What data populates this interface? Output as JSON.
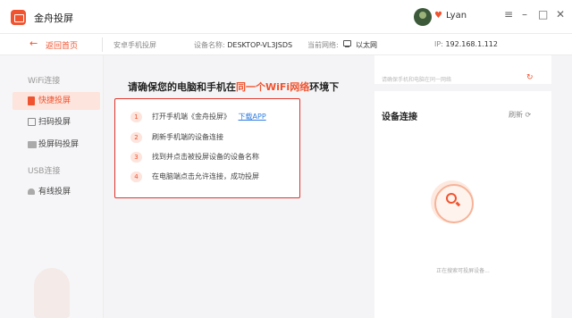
{
  "app": {
    "title": "金舟投屏",
    "user_name": "Lyan",
    "vip_symbol": "♥"
  },
  "window_controls": {
    "menu": "≡",
    "minimize": "–",
    "maximize": "□",
    "close": "✕"
  },
  "navbar": {
    "back_label": "返回首页",
    "back_arrow": "←",
    "mode": "安卓手机投屏",
    "device_label": "设备名称:",
    "device_name": "DESKTOP-VL3JSDS",
    "network_label": "当前网络:",
    "network_value": "以太网",
    "ip_label": "IP:",
    "ip_value": "192.168.1.112"
  },
  "sidebar": {
    "wifi_header": "WiFi连接",
    "usb_header": "USB连接",
    "items": [
      {
        "label": "快捷投屏",
        "icon": "phone-icon",
        "active": true
      },
      {
        "label": "扫码投屏",
        "icon": "qr-icon",
        "active": false
      },
      {
        "label": "投屏码投屏",
        "icon": "code-icon",
        "active": false
      },
      {
        "label": "有线投屏",
        "icon": "android-icon",
        "active": false
      }
    ]
  },
  "main": {
    "title_pre": "请确保您的电脑和手机在",
    "title_highlight": "同一个WiFi网络",
    "title_post": "环境下",
    "steps": [
      {
        "num": "1",
        "text": "打开手机端《金舟投屏》",
        "link": "下载APP"
      },
      {
        "num": "2",
        "text": "刷新手机端的设备连接"
      },
      {
        "num": "3",
        "text": "找到并点击被投屏设备的设备名称"
      },
      {
        "num": "4",
        "text": "在电脑端点击允许连接，成功投屏"
      }
    ]
  },
  "devices_panel": {
    "top_hint": "请确保手机和电脑在同一网络",
    "top_icon": "↻",
    "title": "设备连接",
    "refresh_label": "刷新",
    "refresh_icon": "⟳",
    "searching_text": "正在搜索可投屏设备..."
  },
  "colors": {
    "accent": "#f0532f",
    "link": "#2f7de1",
    "highlight_box": "#e0322a"
  }
}
